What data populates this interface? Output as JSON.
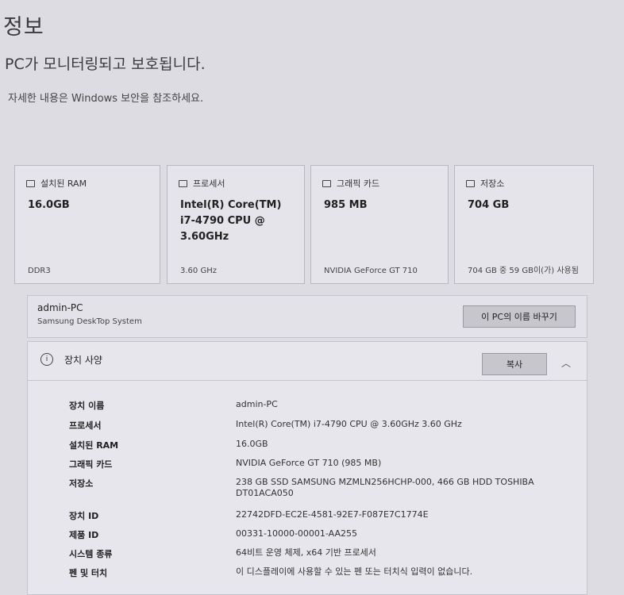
{
  "page": {
    "title": "정보",
    "status": "PC가 모니터링되고 보호됩니다.",
    "subtitle": "자세한 내용은 Windows 보안을 참조하세요."
  },
  "cards": [
    {
      "label": "설치된 RAM",
      "value": "16.0GB",
      "footer": "DDR3",
      "icon": "ram-icon"
    },
    {
      "label": "프로세서",
      "value": "Intel(R) Core(TM) i7-4790 CPU @ 3.60GHz",
      "footer": "3.60 GHz",
      "icon": "processor-icon"
    },
    {
      "label": "그래픽 카드",
      "value": "985 MB",
      "footer": "NVIDIA GeForce GT 710",
      "icon": "graphics-card-icon"
    },
    {
      "label": "저장소",
      "value": "704 GB",
      "footer": "704 GB 중 59 GB이(가) 사용됨",
      "icon": "storage-icon"
    }
  ],
  "pc": {
    "name": "admin-PC",
    "model": "Samsung DeskTop System",
    "rename_label": "이 PC의 이름 바꾸기"
  },
  "specs": {
    "title": "장치 사양",
    "copy_label": "복사",
    "rows": [
      {
        "label": "장치 이름",
        "value": "admin-PC"
      },
      {
        "label": "프로세서",
        "value": "Intel(R) Core(TM) i7-4790 CPU @ 3.60GHz   3.60 GHz"
      },
      {
        "label": "설치된 RAM",
        "value": "16.0GB"
      },
      {
        "label": "그래픽 카드",
        "value": "NVIDIA GeForce GT 710 (985 MB)"
      },
      {
        "label": "저장소",
        "value": "238 GB SSD SAMSUNG MZMLN256HCHP-000, 466 GB HDD TOSHIBA DT01ACA050"
      },
      {
        "label": "장치 ID",
        "value": "22742DFD-EC2E-4581-92E7-F087E7C1774E"
      },
      {
        "label": "제품 ID",
        "value": "00331-10000-00001-AA255"
      },
      {
        "label": "시스템 종류",
        "value": "64비트 운영 체제, x64 기반 프로세서"
      },
      {
        "label": "펜 및 터치",
        "value": "이 디스플레이에 사용할 수 있는 펜 또는 터치식 입력이 없습니다."
      }
    ]
  }
}
